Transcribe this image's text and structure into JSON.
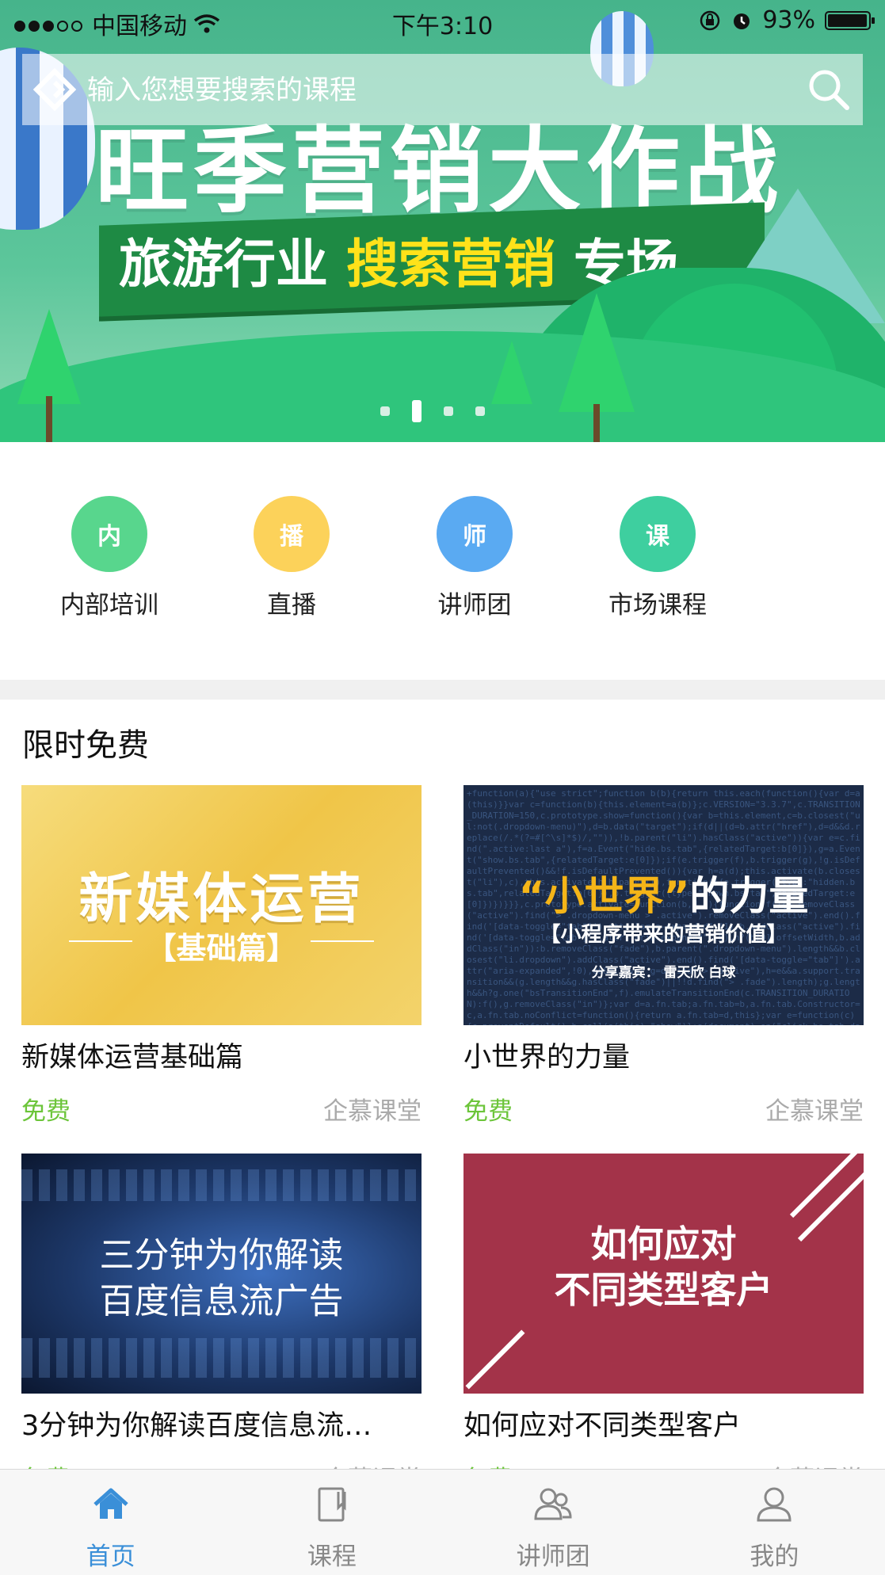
{
  "status_bar": {
    "carrier": "中国移动",
    "time": "下午3:10",
    "battery": "93%",
    "signal_bars": 3,
    "battery_level": 0.93
  },
  "search": {
    "placeholder": "输入您想要搜索的课程"
  },
  "banner": {
    "headline": "旺季营销大作战",
    "ribbon_prefix": "旅游行业 ",
    "ribbon_highlight": "搜索营销",
    "ribbon_suffix": " 专场",
    "page_count": 4,
    "active_page": 2
  },
  "categories": [
    {
      "icon_text": "内",
      "label": "内部培训",
      "color": "#58d68d"
    },
    {
      "icon_text": "播",
      "label": "直播",
      "color": "#fcd25a"
    },
    {
      "icon_text": "师",
      "label": "讲师团",
      "color": "#5aaaf2"
    },
    {
      "icon_text": "课",
      "label": "市场课程",
      "color": "#3ecf9f"
    }
  ],
  "section": {
    "title": "限时免费"
  },
  "courses": [
    {
      "title": "新媒体运营基础篇",
      "price": "免费",
      "org": "企慕课堂",
      "thumb_title": "新媒体运营",
      "thumb_sub": "【基础篇】"
    },
    {
      "title": "小世界的力量",
      "price": "免费",
      "org": "企慕课堂",
      "thumb_title_highlight": "“小世界”",
      "thumb_title_rest": "的力量",
      "thumb_sub": "【小程序带来的营销价值】",
      "thumb_speaker": "分享嘉宾： 雷天欣  白球"
    },
    {
      "title": "3分钟为你解读百度信息流…",
      "price": "免费",
      "org": "企慕课堂",
      "thumb_line1": "三分钟为你解读",
      "thumb_line2": "百度信息流广告"
    },
    {
      "title": "如何应对不同类型客户",
      "price": "免费",
      "org": "企慕课堂",
      "thumb_line1": "如何应对",
      "thumb_line2": "不同类型客户"
    }
  ],
  "tabbar": {
    "items": [
      {
        "label": "首页",
        "icon": "home-icon",
        "active": true
      },
      {
        "label": "课程",
        "icon": "book-icon",
        "active": false
      },
      {
        "label": "讲师团",
        "icon": "group-icon",
        "active": false
      },
      {
        "label": "我的",
        "icon": "user-icon",
        "active": false
      }
    ],
    "active_color": "#3a8fd8",
    "inactive_color": "#888888"
  }
}
